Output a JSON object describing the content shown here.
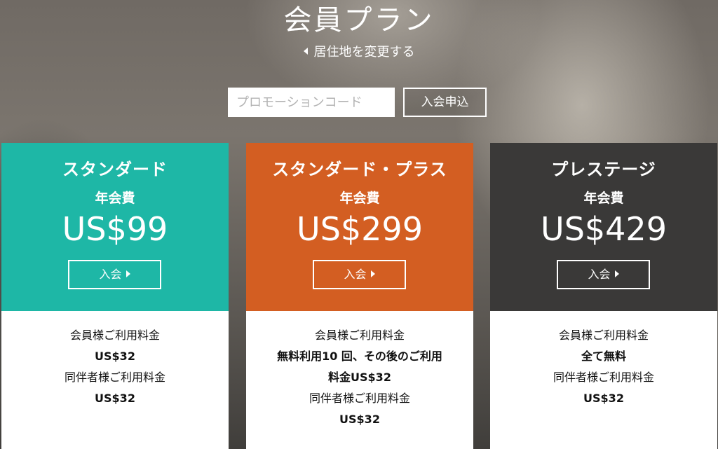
{
  "header": {
    "title": "会員プラン",
    "change_residence": "居住地を変更する"
  },
  "promo": {
    "placeholder": "プロモーションコード",
    "value": "",
    "apply_label": "入会申込"
  },
  "plans": [
    {
      "name": "スタンダード",
      "fee_label": "年会費",
      "price": "US$99",
      "join_label": "入会",
      "color": "#1eb7a6",
      "member_fee_label": "会員様ご利用料金",
      "member_fee": "US$32",
      "guest_fee_label": "同伴者様ご利用料金",
      "guest_fee": "US$32"
    },
    {
      "name": "スタンダード・プラス",
      "fee_label": "年会費",
      "price": "US$299",
      "join_label": "入会",
      "color": "#d35e22",
      "member_fee_label": "会員様ご利用料金",
      "member_fee_line1": "無料利用10 回、その後のご利用",
      "member_fee_line2": "料金US$32",
      "guest_fee_label": "同伴者様ご利用料金",
      "guest_fee": "US$32"
    },
    {
      "name": "プレステージ",
      "fee_label": "年会費",
      "price": "US$429",
      "join_label": "入会",
      "color": "#3a3938",
      "member_fee_label": "会員様ご利用料金",
      "member_fee": "全て無料",
      "guest_fee_label": "同伴者様ご利用料金",
      "guest_fee": "US$32"
    }
  ],
  "icons": {
    "change_residence": "caret-left-icon",
    "join": "caret-right-icon"
  }
}
